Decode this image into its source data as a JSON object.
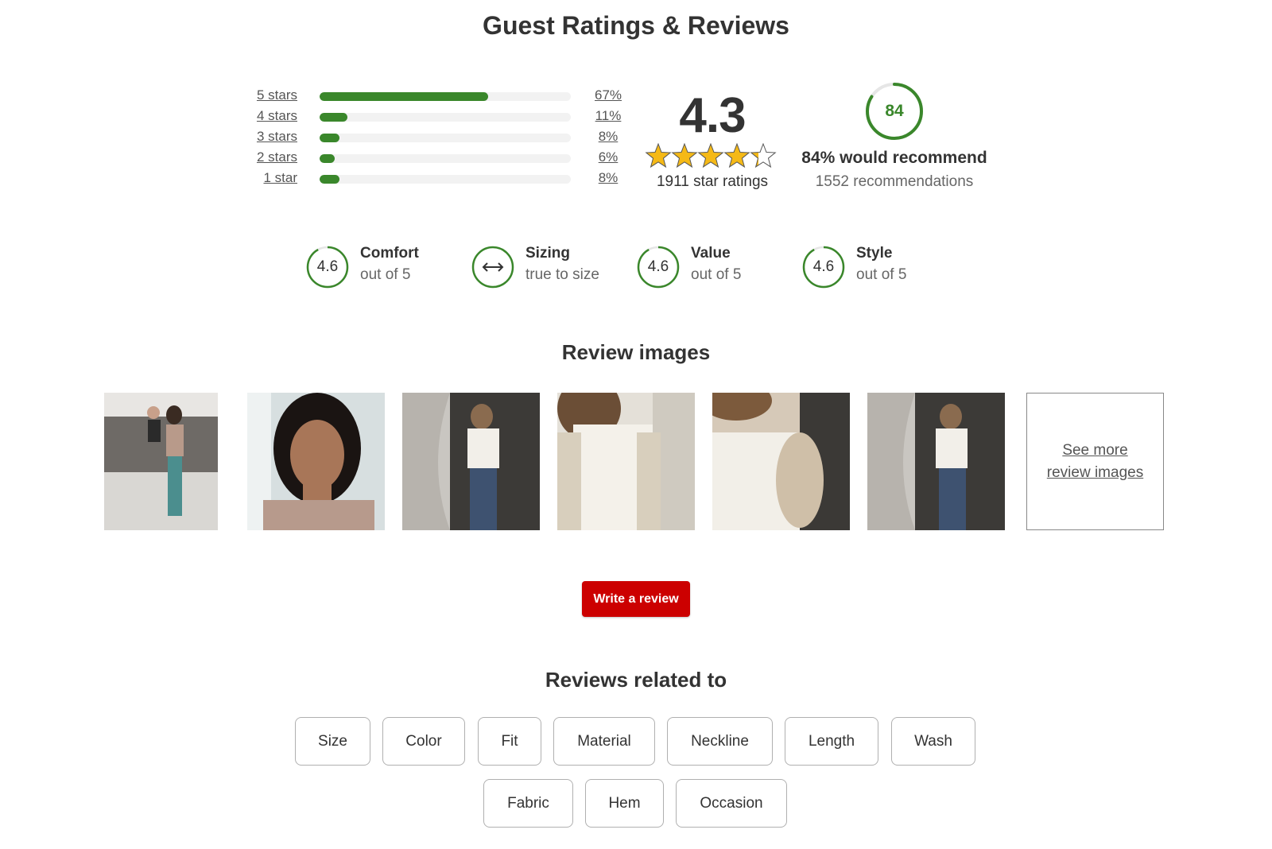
{
  "title": "Guest Ratings & Reviews",
  "rating_histogram": [
    {
      "label": "5 stars",
      "percent_text": "67%",
      "fraction": 0.67
    },
    {
      "label": "4 stars",
      "percent_text": "11%",
      "fraction": 0.11
    },
    {
      "label": "3 stars",
      "percent_text": "8%",
      "fraction": 0.08
    },
    {
      "label": "2 stars",
      "percent_text": "6%",
      "fraction": 0.06
    },
    {
      "label": "1 star",
      "percent_text": "8%",
      "fraction": 0.08
    }
  ],
  "average": {
    "value": "4.3",
    "stars_filled": 4.3,
    "stars_max": 5,
    "count_text": "1911 star ratings"
  },
  "recommend": {
    "value": "84",
    "fraction": 0.84,
    "title": "84% would recommend",
    "subtitle": "1552 recommendations"
  },
  "attributes": [
    {
      "value": "4.6",
      "name": "Comfort",
      "sub": "out of 5"
    },
    {
      "value": "",
      "icon": "double-arrow-icon",
      "name": "Sizing",
      "sub": "true to size"
    },
    {
      "value": "4.6",
      "name": "Value",
      "sub": "out of 5"
    },
    {
      "value": "4.6",
      "name": "Style",
      "sub": "out of 5"
    }
  ],
  "review_images": {
    "title": "Review images",
    "see_more": "See more review images"
  },
  "write_review_label": "Write a review",
  "related": {
    "title": "Reviews related to",
    "chips_row1": [
      "Size",
      "Color",
      "Fit",
      "Material",
      "Neckline",
      "Length",
      "Wash"
    ],
    "chips_row2": [
      "Fabric",
      "Hem",
      "Occasion"
    ]
  },
  "colors": {
    "accent_green": "#3a872b",
    "star_gold": "#f5b916",
    "button_red": "#cc0000"
  }
}
